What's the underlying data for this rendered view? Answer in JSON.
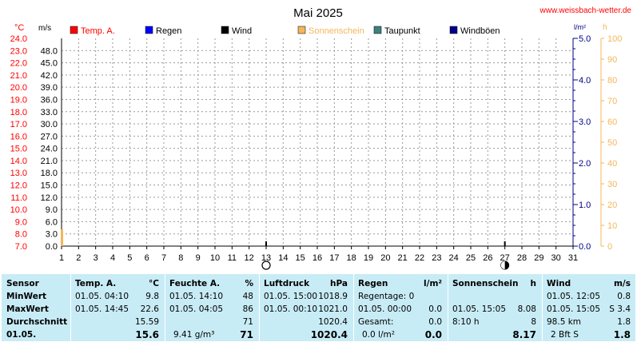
{
  "header": {
    "title": "Mai 2025",
    "website": "www.weissbach-wetter.de",
    "unit_temp": "°C",
    "unit_wind": "m/s",
    "unit_rain": "l/m²",
    "unit_sun": "h"
  },
  "legend": [
    {
      "label": "Temp. A.",
      "color": "#ff0000",
      "icon": "red-square"
    },
    {
      "label": "Regen",
      "color": "#0000ff",
      "icon": "blue-square"
    },
    {
      "label": "Wind",
      "color": "#000000",
      "icon": "black-square"
    },
    {
      "label": "Sonnenschein",
      "color": "#f5b55a",
      "icon": "orange-square"
    },
    {
      "label": "Taupunkt",
      "color": "#3f8080",
      "icon": "teal-square"
    },
    {
      "label": "Windböen",
      "color": "#00008b",
      "icon": "navy-square"
    }
  ],
  "chart_data": {
    "type": "bar",
    "title": "Mai 2025",
    "x": {
      "ticks": [
        "1",
        "2",
        "3",
        "4",
        "5",
        "6",
        "7",
        "8",
        "9",
        "10",
        "11",
        "12",
        "13",
        "14",
        "15",
        "16",
        "17",
        "18",
        "19",
        "20",
        "21",
        "22",
        "23",
        "24",
        "25",
        "26",
        "27",
        "28",
        "29",
        "30",
        "31"
      ],
      "range": [
        1,
        31
      ]
    },
    "axes": {
      "temp": {
        "label": "°C",
        "ylim": [
          7,
          24
        ],
        "ticks": [
          "24.0",
          "23.0",
          "22.0",
          "21.0",
          "20.0",
          "19.0",
          "18.0",
          "17.0",
          "16.0",
          "15.0",
          "14.0",
          "13.0",
          "12.0",
          "11.0",
          "10.0",
          "9.0",
          "8.0",
          "7.0"
        ],
        "color": "#ff0000"
      },
      "wind": {
        "label": "m/s",
        "ylim": [
          0,
          51
        ],
        "ticks": [
          "48.0",
          "45.0",
          "42.0",
          "39.0",
          "36.0",
          "33.0",
          "30.0",
          "27.0",
          "24.0",
          "21.0",
          "18.0",
          "15.0",
          "12.0",
          "9.0",
          "6.0",
          "3.0",
          "0.0"
        ],
        "color": "#000000"
      },
      "rain": {
        "label": "l/m²",
        "ylim": [
          0,
          5
        ],
        "ticks": [
          "5.0",
          "4.0",
          "3.0",
          "2.0",
          "1.0",
          "0.0"
        ],
        "color": "#00008b"
      },
      "sun": {
        "label": "h",
        "ylim": [
          0,
          100
        ],
        "ticks": [
          "100",
          "90",
          "80",
          "70",
          "60",
          "50",
          "40",
          "30",
          "20",
          "10",
          "0"
        ],
        "color": "#f5b55a"
      }
    },
    "series": [
      {
        "name": "Sonnenschein",
        "axis": "sun",
        "color": "#f5b55a",
        "points": [
          {
            "x": 1,
            "y": 8.08
          }
        ]
      }
    ],
    "moon_markers": [
      {
        "day": 13,
        "phase": "full",
        "icon": "full-moon-icon"
      },
      {
        "day": 27,
        "phase": "new",
        "icon": "new-moon-icon"
      }
    ],
    "grid": true
  },
  "stats": {
    "sensor": {
      "header": "Sensor",
      "rows": [
        "MinWert",
        "MaxWert",
        "Durchschnitt",
        "01.05."
      ]
    },
    "temp": {
      "header": "Temp. A.",
      "unit": "°C",
      "min_time": "01.05.  04:10",
      "min_val": "9.8",
      "max_time": "01.05.  14:45",
      "max_val": "22.6",
      "avg": "15.59",
      "today": "15.6"
    },
    "humidity": {
      "header": "Feuchte A.",
      "unit": "%",
      "min_time": "01.05.  14:10",
      "min_val": "48",
      "max_time": "01.05.  04:05",
      "max_val": "86",
      "avg": "71",
      "today_abs": "9.41 g/m³",
      "today": "71"
    },
    "pressure": {
      "header": "Luftdruck",
      "unit": "hPa",
      "min_time": "01.05.  15:00",
      "min_val": "1018.9",
      "max_time": "01.05.  00:10",
      "max_val": "1021.0",
      "avg": "1020.4",
      "today": "1020.4"
    },
    "rain": {
      "header": "Regen",
      "unit": "l/m²",
      "raindays": "Regentage: 0",
      "max_time": "01.05.  00:00",
      "max_val": "0.0",
      "total_label": "Gesamt:",
      "total_val": "0.0",
      "today_sub": "0.0 l/m²",
      "today": "0.0"
    },
    "sun": {
      "header": "Sonnenschein",
      "unit": "h",
      "max_time": "01.05.  15:05",
      "max_val": "8.08",
      "total_label": "8:10 h",
      "total_val": "8",
      "today": "8.17"
    },
    "wind": {
      "header": "Wind",
      "unit": "m/s",
      "min_time": "01.05.  12:05",
      "min_val": "0.8",
      "max_time": "01.05.  15:05",
      "max_val": "S 3.4",
      "avg_label": "98.5 km",
      "avg": "1.8",
      "today_sub": "2 Bft S",
      "today": "1.8"
    }
  }
}
